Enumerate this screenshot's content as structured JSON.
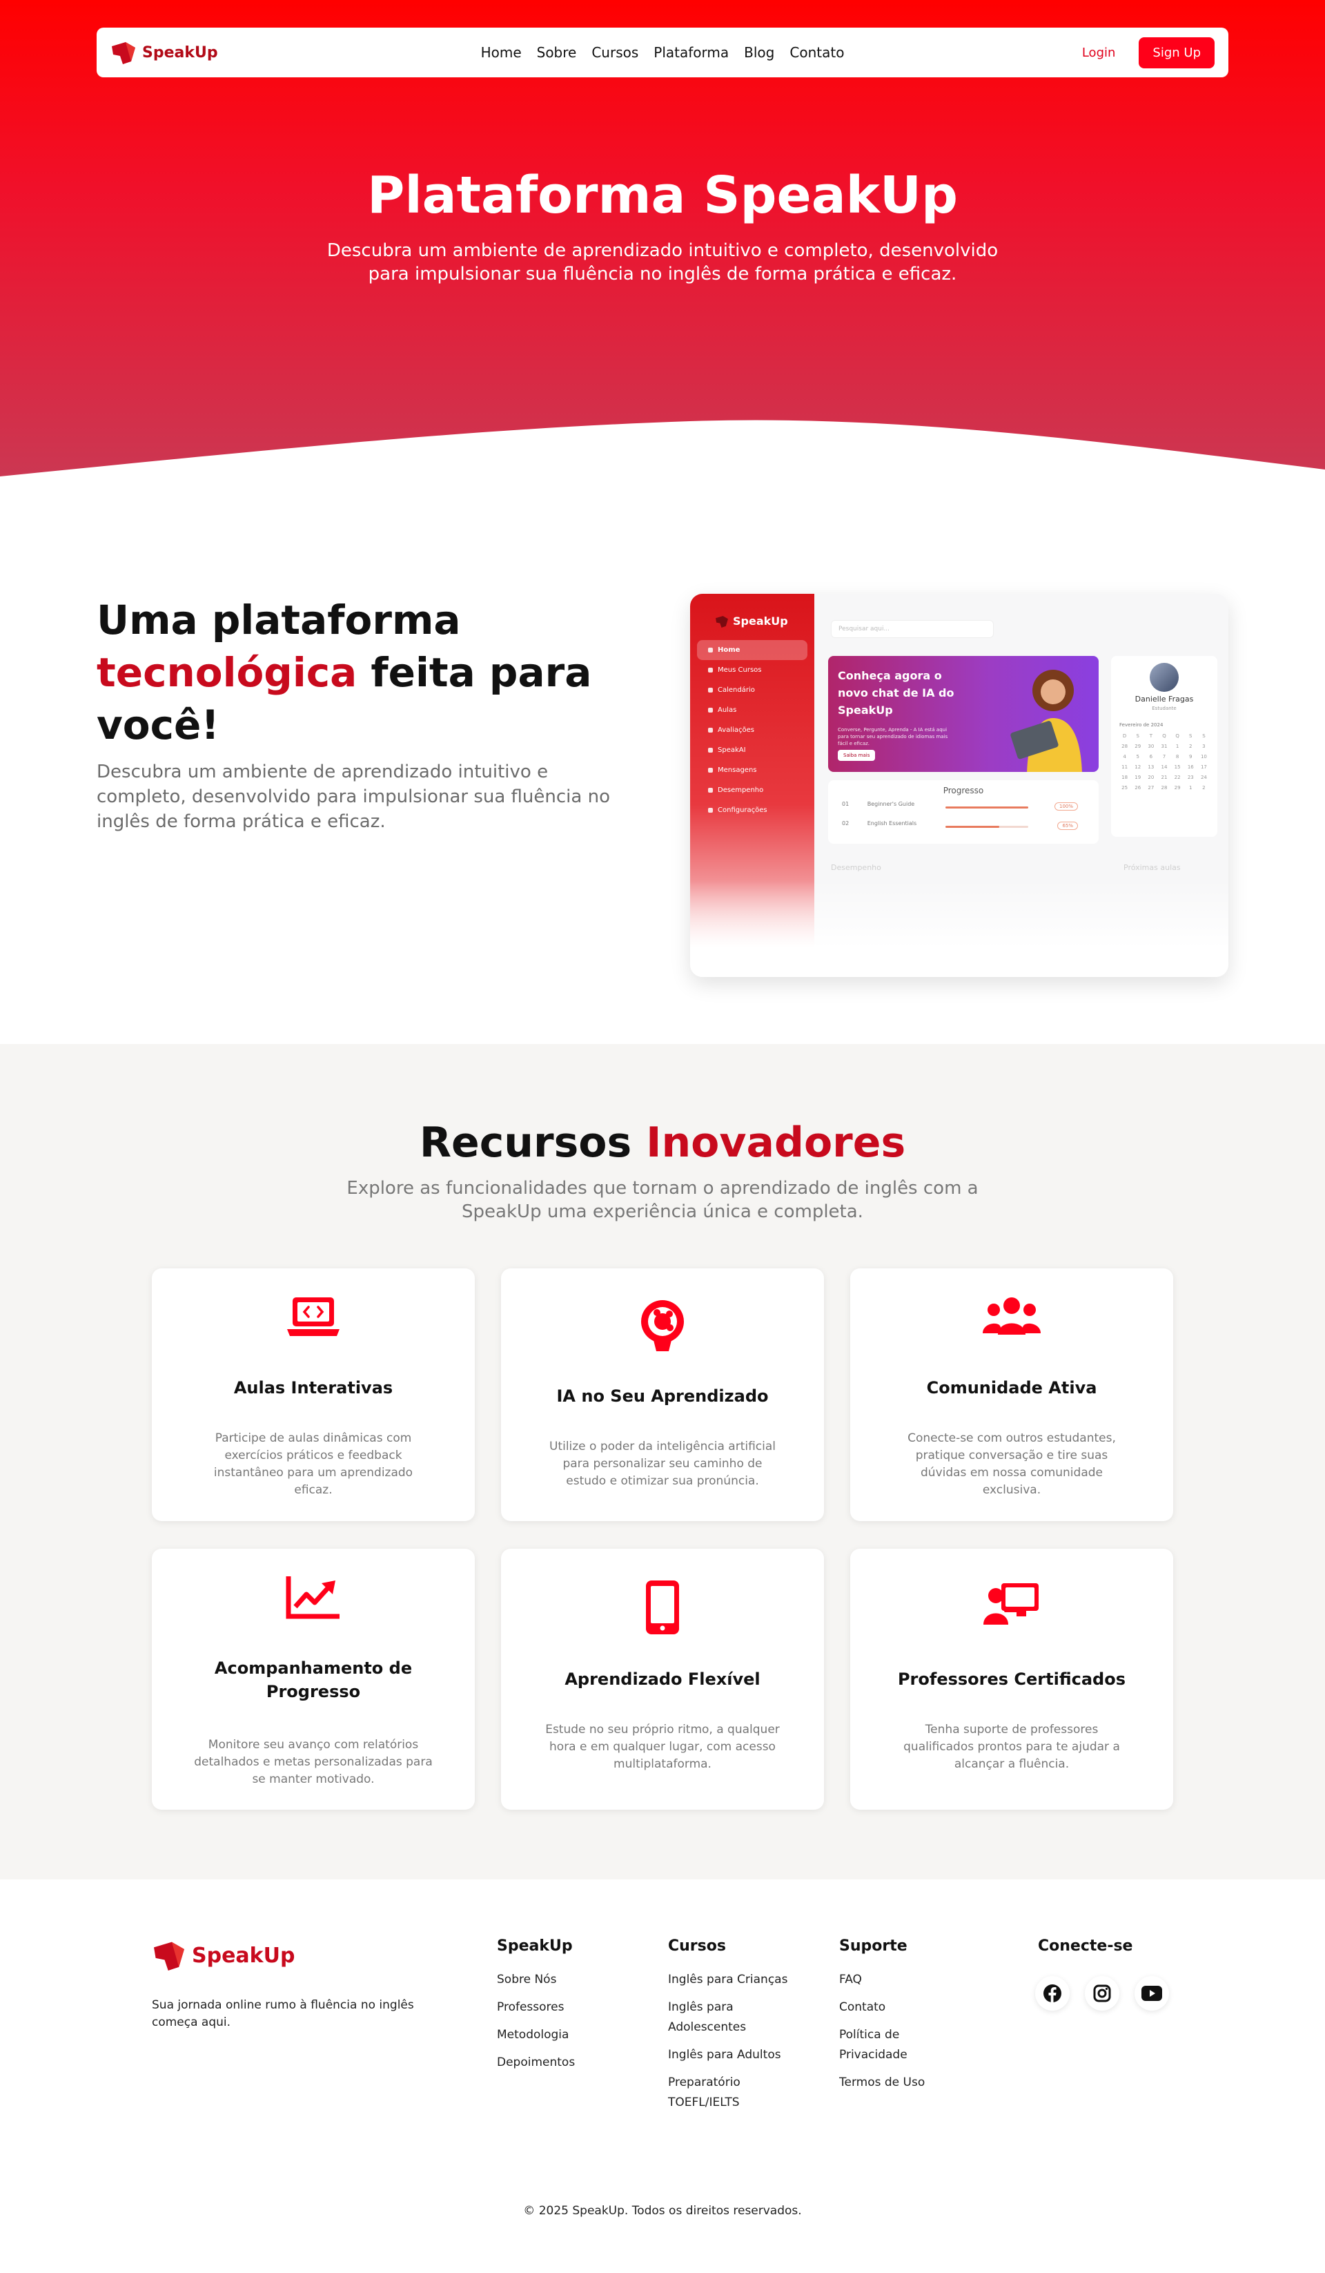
{
  "nav": {
    "brand": "SpeakUp",
    "links": [
      "Home",
      "Sobre",
      "Cursos",
      "Plataforma",
      "Blog",
      "Contato"
    ],
    "login": "Login",
    "signup": "Sign Up"
  },
  "hero": {
    "title": "Plataforma SpeakUp",
    "subtitle": "Descubra um ambiente de aprendizado intuitivo e completo, desenvolvido para impulsionar sua fluência no inglês de forma prática e eficaz."
  },
  "tech": {
    "title_part1": "Uma plataforma ",
    "title_accent": "tecnológica",
    "title_part2": " feita para você!",
    "description": "Descubra um ambiente de aprendizado intuitivo e completo, desenvolvido para impulsionar sua fluência no inglês de forma prática e eficaz.",
    "mockup": {
      "brand": "SpeakUp",
      "menu": [
        "Home",
        "Meus Cursos",
        "Calendário",
        "Aulas",
        "Avaliações",
        "SpeakAI",
        "Mensagens",
        "Desempenho",
        "Configurações"
      ],
      "search_placeholder": "Pesquisar aqui...",
      "banner_title": "Conheça agora o novo chat de IA do SpeakUp",
      "banner_text": "Converse, Pergunte, Aprenda - A IA está aqui para tornar seu aprendizado de idiomas mais fácil e eficaz.",
      "banner_button": "Saiba mais",
      "progress_title": "Progresso",
      "progress_rows": [
        {
          "num": "01",
          "course": "Beginner's Guide",
          "pct": 100,
          "label": "100%"
        },
        {
          "num": "02",
          "course": "English Essentials",
          "pct": 65,
          "label": "65%"
        }
      ],
      "profile_name": "Danielle Fragas",
      "profile_role": "Estudante",
      "calendar_month": "Fevereiro de 2024",
      "calendar_days": [
        "D",
        "S",
        "T",
        "Q",
        "Q",
        "S",
        "S",
        "28",
        "29",
        "30",
        "31",
        "1",
        "2",
        "3",
        "4",
        "5",
        "6",
        "7",
        "8",
        "9",
        "10",
        "11",
        "12",
        "13",
        "14",
        "15",
        "16",
        "17",
        "18",
        "19",
        "20",
        "21",
        "22",
        "23",
        "24",
        "25",
        "26",
        "27",
        "28",
        "29",
        "1",
        "2"
      ],
      "next_classes": "Próximas aulas",
      "performance": "Desempenho"
    }
  },
  "resources": {
    "title_part1": "Recursos ",
    "title_accent": "Inovadores",
    "subtitle": "Explore as funcionalidades que tornam o aprendizado de inglês com a SpeakUp uma experiência única e completa.",
    "cards": [
      {
        "icon": "laptop-code-icon",
        "title": "Aulas Interativas",
        "desc": "Participe de aulas dinâmicas com exercícios práticos e feedback instantâneo para um aprendizado eficaz."
      },
      {
        "icon": "ai-brain-icon",
        "title": "IA no Seu Aprendizado",
        "desc": "Utilize o poder da inteligência artificial para personalizar seu caminho de estudo e otimizar sua pronúncia."
      },
      {
        "icon": "users-icon",
        "title": "Comunidade Ativa",
        "desc": "Conecte-se com outros estudantes, pratique conversação e tire suas dúvidas em nossa comunidade exclusiva."
      },
      {
        "icon": "chart-line-icon",
        "title": "Acompanhamento de Progresso",
        "desc": "Monitore seu avanço com relatórios detalhados e metas personalizadas para se manter motivado."
      },
      {
        "icon": "mobile-icon",
        "title": "Aprendizado Flexível",
        "desc": "Estude no seu próprio ritmo, a qualquer hora e em qualquer lugar, com acesso multiplataforma."
      },
      {
        "icon": "teacher-board-icon",
        "title": "Professores Certificados",
        "desc": "Tenha suporte de professores qualificados prontos para te ajudar a alcançar a fluência."
      }
    ]
  },
  "footer": {
    "brand": "SpeakUp",
    "tagline": "Sua jornada online rumo à fluência no inglês começa aqui.",
    "columns": [
      {
        "title": "SpeakUp",
        "links": [
          "Sobre Nós",
          "Professores",
          "Metodologia",
          "Depoimentos"
        ]
      },
      {
        "title": "Cursos",
        "links": [
          "Inglês para Crianças",
          "Inglês para Adolescentes",
          "Inglês para Adultos",
          "Preparatório TOEFL/IELTS"
        ]
      },
      {
        "title": "Suporte",
        "links": [
          "FAQ",
          "Contato",
          "Política de Privacidade",
          "Termos de Uso"
        ]
      }
    ],
    "social_title": "Conecte-se",
    "socials": [
      "facebook-icon",
      "instagram-icon",
      "youtube-icon"
    ],
    "copyright": "© 2025 SpeakUp. Todos os direitos reservados."
  },
  "colors": {
    "brand_red": "#ff0019",
    "accent_dark_red": "#c80a1d",
    "section_bg": "#f6f5f3"
  }
}
